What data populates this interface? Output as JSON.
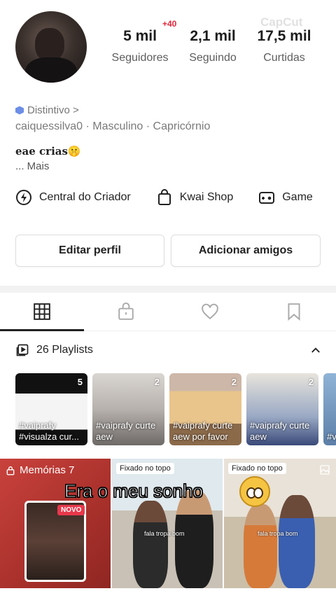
{
  "watermark": "CapCut",
  "profile": {
    "stats": [
      {
        "value": "5 mil",
        "label": "Seguidores"
      },
      {
        "value": "2,1 mil",
        "label": "Seguindo"
      },
      {
        "value": "17,5 mil",
        "label": "Curtidas"
      }
    ],
    "followers_badge": "+40",
    "distintivo": "Distintivo >",
    "meta": "caiquessilva0  ·  Masculino  ·  Capricórnio",
    "bio": "eae crias🤫",
    "more": "...  Mais"
  },
  "features": [
    {
      "label": "Central do Criador",
      "icon": "lightning-circle-icon"
    },
    {
      "label": "Kwai Shop",
      "icon": "shopping-bag-icon"
    },
    {
      "label": "Game",
      "icon": "gamepad-icon"
    }
  ],
  "buttons": {
    "edit": "Editar perfil",
    "add": "Adicionar amigos"
  },
  "tabs": [
    "grid-icon",
    "lock-bag-icon",
    "heart-icon",
    "bookmark-icon"
  ],
  "playlists": {
    "header": "26 Playlists",
    "items": [
      {
        "count": "5",
        "title": "#vaiprafy #visualza cur..."
      },
      {
        "count": "2",
        "title": "#vaiprafy curte aew"
      },
      {
        "count": "2",
        "title": "#vaiprafy curte aew por favor"
      },
      {
        "count": "2",
        "title": "#vaiprafy curte aew"
      },
      {
        "count": "",
        "title": "#va"
      }
    ]
  },
  "grid": {
    "memories": "Memórias 7",
    "novo": "NOVO",
    "pinned": "Fixado no topo",
    "caption": "fala tropa bom"
  },
  "overlay_caption": "Era o meu sonho"
}
